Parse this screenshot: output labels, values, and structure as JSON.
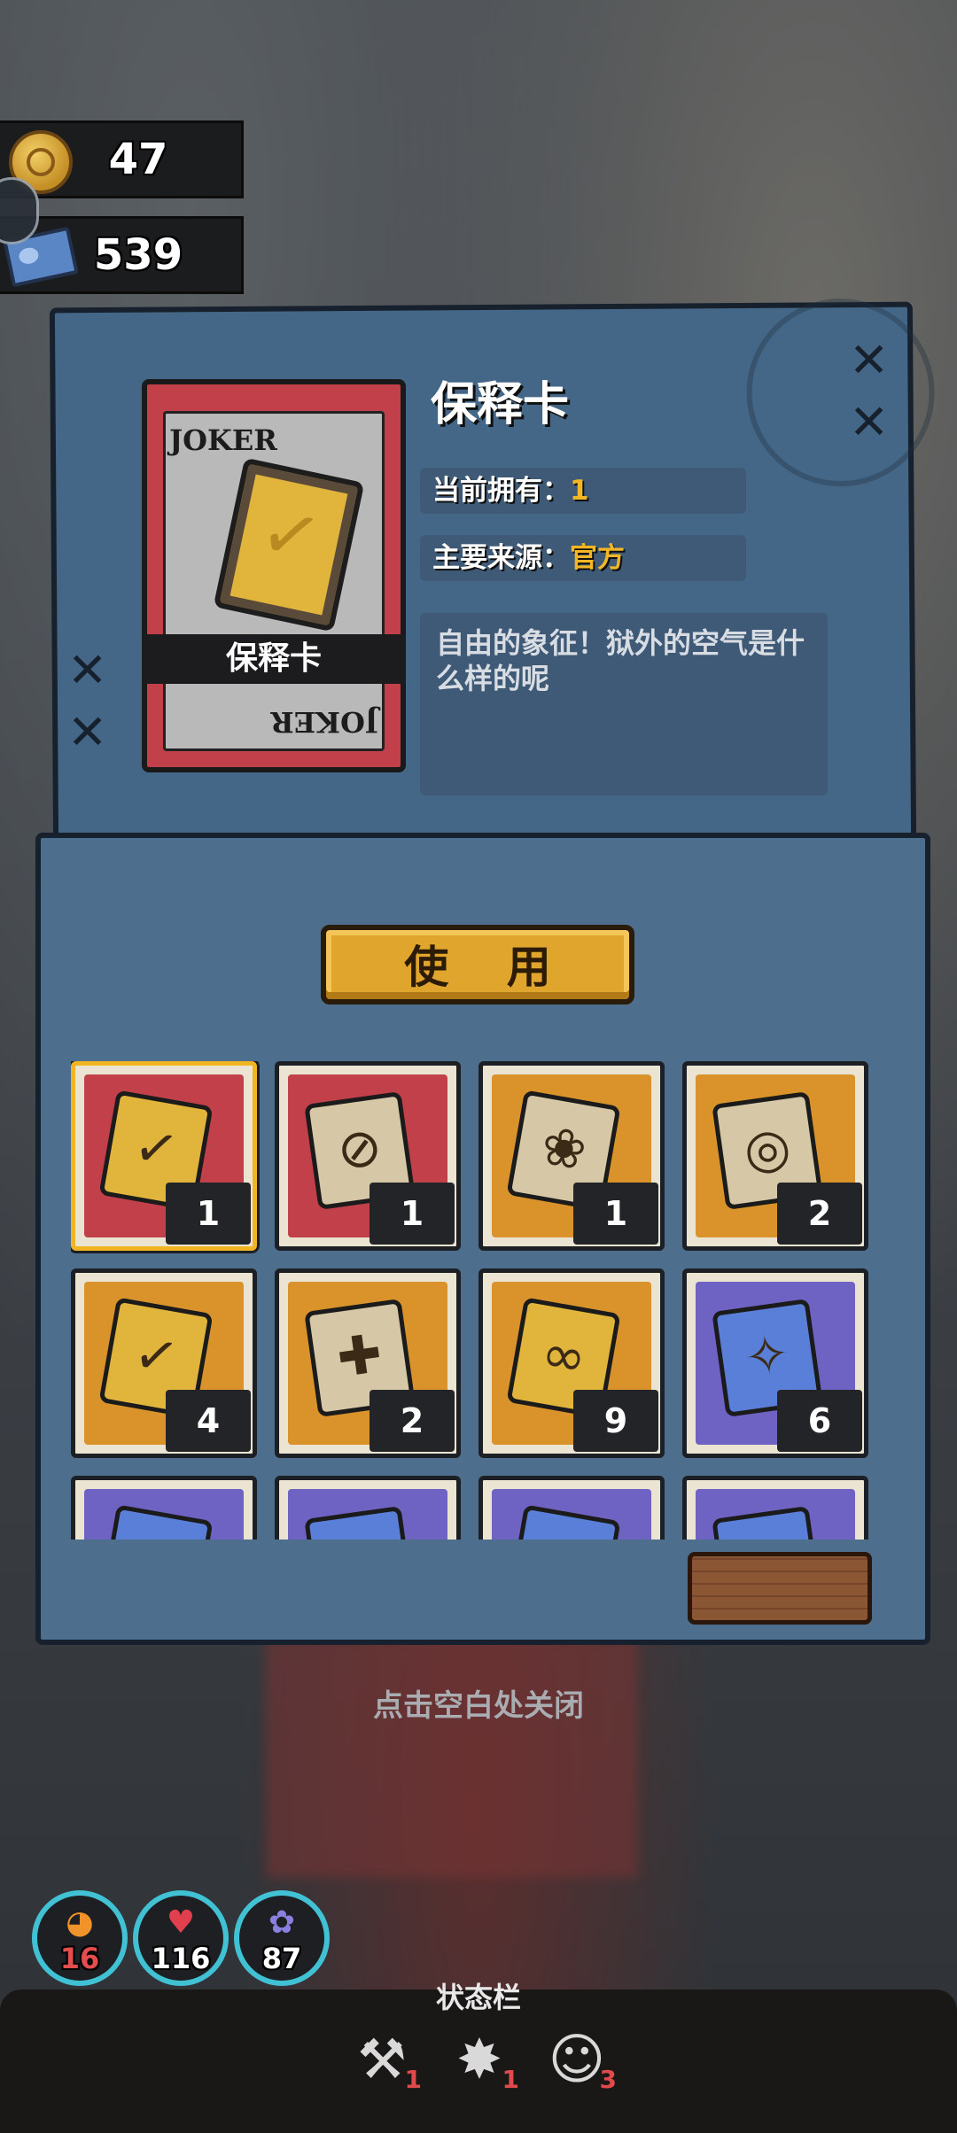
{
  "resources": {
    "coins": "47",
    "tickets": "539"
  },
  "item": {
    "name": "保释卡",
    "card_label": "保释卡",
    "joker_text": "JOKER",
    "owned_label": "当前拥有：",
    "owned_value": "1",
    "source_label": "主要来源：",
    "source_value": "官方",
    "description": "自由的象征！狱外的空气是什么样的呢"
  },
  "use_button": "使 用",
  "inventory": [
    {
      "name": "bail-card",
      "count": "1",
      "bg": "red",
      "selected": true
    },
    {
      "name": "forbidden-ticket",
      "count": "1",
      "bg": "red"
    },
    {
      "name": "paw-scroll",
      "count": "1",
      "bg": "orange"
    },
    {
      "name": "film-reel",
      "count": "2",
      "bg": "orange"
    },
    {
      "name": "bail-card-star",
      "count": "4",
      "bg": "orange"
    },
    {
      "name": "medical-card",
      "count": "2",
      "bg": "orange"
    },
    {
      "name": "ribbon-card",
      "count": "9",
      "bg": "orange"
    },
    {
      "name": "bow-ticket",
      "count": "6",
      "bg": "purple"
    },
    {
      "name": "item-9",
      "count": "",
      "bg": "purple"
    },
    {
      "name": "item-10",
      "count": "",
      "bg": "purple"
    },
    {
      "name": "item-11",
      "count": "",
      "bg": "purple"
    },
    {
      "name": "item-12",
      "count": "",
      "bg": "purple"
    }
  ],
  "close_hint": "点击空白处关闭",
  "stats": {
    "hunger": "16",
    "health": "116",
    "sanity": "87"
  },
  "status_bar": {
    "label": "状态栏",
    "items": [
      {
        "icon": "broken-tools-icon",
        "count": "1"
      },
      {
        "icon": "explosion-icon",
        "count": "1"
      },
      {
        "icon": "mask-icon",
        "count": "3"
      }
    ]
  }
}
